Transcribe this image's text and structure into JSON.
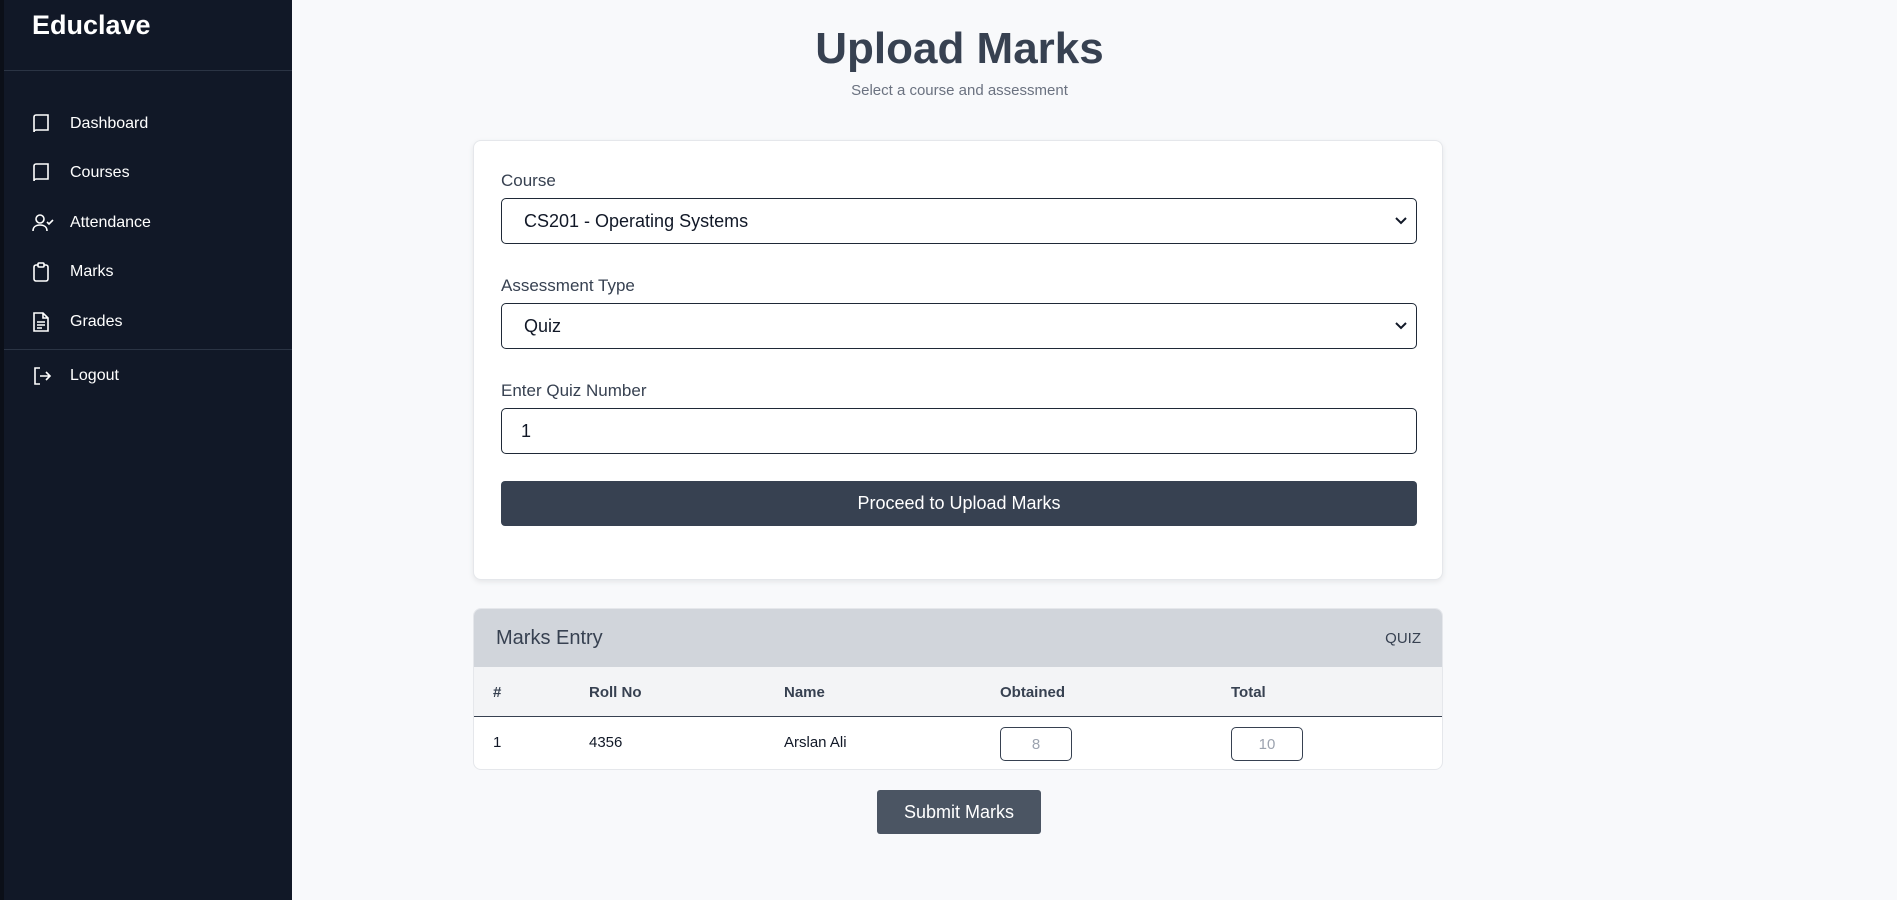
{
  "app": {
    "brand": "Educlave"
  },
  "sidebar": {
    "items": [
      {
        "label": "Dashboard",
        "icon": "book-icon"
      },
      {
        "label": "Courses",
        "icon": "book-icon"
      },
      {
        "label": "Attendance",
        "icon": "user-check-icon"
      },
      {
        "label": "Marks",
        "icon": "clipboard-icon"
      },
      {
        "label": "Grades",
        "icon": "document-icon"
      }
    ],
    "logout": {
      "label": "Logout",
      "icon": "logout-icon"
    }
  },
  "page": {
    "title": "Upload Marks",
    "subtitle": "Select a course and assessment"
  },
  "form": {
    "course_label": "Course",
    "course_value": "CS201 - Operating Systems",
    "assessment_label": "Assessment Type",
    "assessment_value": "Quiz",
    "quiz_number_label": "Enter Quiz Number",
    "quiz_number_value": "1",
    "proceed_label": "Proceed to Upload Marks"
  },
  "marks_entry": {
    "title": "Marks Entry",
    "tag": "QUIZ",
    "columns": [
      "#",
      "Roll No",
      "Name",
      "Obtained",
      "Total"
    ],
    "rows": [
      {
        "index": "1",
        "roll_no": "4356",
        "name": "Arslan Ali",
        "obtained_placeholder": "8",
        "total_placeholder": "10"
      }
    ]
  },
  "submit_label": "Submit Marks",
  "colors": {
    "sidebar_bg": "#111827",
    "primary_button": "#374151",
    "submit_button": "#4b5563",
    "table_header_bg": "#d1d5db"
  }
}
